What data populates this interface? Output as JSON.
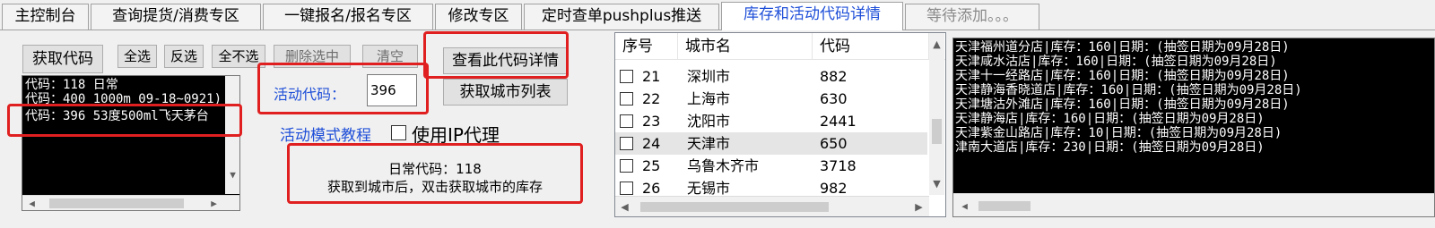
{
  "tabs": [
    {
      "label": "主控制台"
    },
    {
      "label": "查询提货/消费专区"
    },
    {
      "label": "一键报名/报名专区"
    },
    {
      "label": "修改专区"
    },
    {
      "label": "定时查单pushplus推送"
    },
    {
      "label": "库存和活动代码详情"
    },
    {
      "label": "等待添加。。。"
    }
  ],
  "toolbar": {
    "get_code": "获取代码",
    "select_all": "全选",
    "invert": "反选",
    "select_none": "全不选",
    "delete_selected": "删除选中",
    "clear": "清空",
    "view_code_detail": "查看此代码详情",
    "get_city_list": "获取城市列表"
  },
  "code_list": [
    "代码：118  日常",
    "代码：400 1000m 09-18~0921)",
    "代码：396  53度500ml飞天茅台"
  ],
  "activity": {
    "label": "活动代码：",
    "value": "396",
    "tutorial_link": "活动模式教程",
    "proxy_label": "使用IP代理"
  },
  "info": {
    "line1": "日常代码：118",
    "line2": "获取到城市后，双击获取城市的库存"
  },
  "city_table": {
    "headers": {
      "seq": "序号",
      "city": "城市名",
      "code": "代码"
    },
    "rows": [
      {
        "seq": "21",
        "city": "深圳市",
        "code": "882"
      },
      {
        "seq": "22",
        "city": "上海市",
        "code": "630"
      },
      {
        "seq": "23",
        "city": "沈阳市",
        "code": "2441"
      },
      {
        "seq": "24",
        "city": "天津市",
        "code": "650"
      },
      {
        "seq": "25",
        "city": "乌鲁木齐市",
        "code": "3718"
      },
      {
        "seq": "26",
        "city": "无锡市",
        "code": "982"
      }
    ]
  },
  "stock_output": [
    "天津福州道分店|库存：160|日期：(抽签日期为09月28日)",
    "天津咸水沽店|库存：160|日期：(抽签日期为09月28日)",
    "天津十一经路店|库存：160|日期：(抽签日期为09月28日)",
    "天津静海香晓道店|库存：160|日期：(抽签日期为09月28日)",
    "天津塘沽外滩店|库存：160|日期：(抽签日期为09月28日)",
    "天津静海店|库存：160|日期：(抽签日期为09月28日)",
    "天津紫金山路店|库存：10|日期：(抽签日期为09月28日)",
    "津南大道店|库存：230|日期：(抽签日期为09月28日)"
  ],
  "colors": {
    "highlight_box": "#e02020",
    "active_tab_text": "#1f4fd8",
    "link": "#1f4fd8",
    "console_bg": "#000000",
    "console_text": "#ffffff"
  },
  "icons": {
    "scroll_left": "◀",
    "scroll_right": "▶",
    "scroll_up": "▲",
    "scroll_down": "▼"
  }
}
